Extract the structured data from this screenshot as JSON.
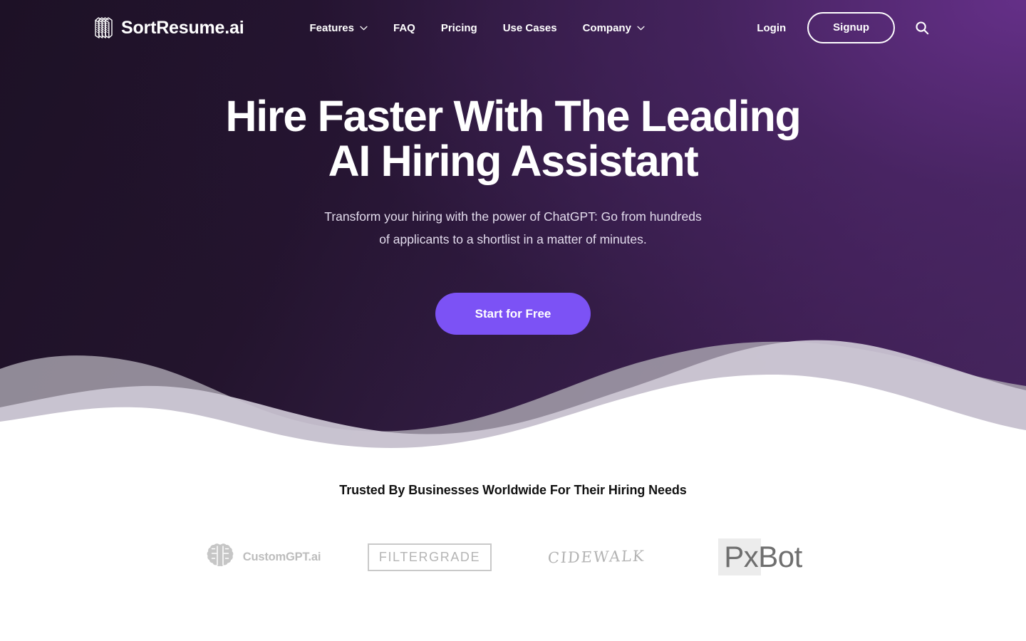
{
  "brand": {
    "name": "SortResume.ai",
    "icon": "stacked-documents-icon"
  },
  "nav": {
    "items": [
      {
        "label": "Features",
        "has_dropdown": true
      },
      {
        "label": "FAQ",
        "has_dropdown": false
      },
      {
        "label": "Pricing",
        "has_dropdown": false
      },
      {
        "label": "Use Cases",
        "has_dropdown": false
      },
      {
        "label": "Company",
        "has_dropdown": true
      }
    ]
  },
  "header_actions": {
    "login_label": "Login",
    "signup_label": "Signup",
    "search_icon": "search-icon"
  },
  "hero": {
    "title_line1": "Hire Faster With The Leading",
    "title_line2": "AI Hiring Assistant",
    "subtitle_line1": "Transform your hiring with the power of ChatGPT: Go from hundreds",
    "subtitle_line2": "of applicants to a shortlist in a matter of minutes.",
    "cta_label": "Start for Free"
  },
  "trusted": {
    "title": "Trusted By Businesses Worldwide For Their Hiring Needs",
    "logos": [
      {
        "name": "CustomGPT.ai",
        "text": "CustomGPT.ai",
        "style": "brain-icon-wordmark"
      },
      {
        "name": "FilterGrade",
        "text": "FILTERGRADE",
        "style": "boxed-wordmark"
      },
      {
        "name": "Cidewalk",
        "text": "CIDEWALK",
        "style": "handwritten-wordmark"
      },
      {
        "name": "PxBot",
        "text": "PxBot",
        "style": "block-wordmark"
      }
    ]
  },
  "colors": {
    "hero_gradient_dark": "#1d1126",
    "hero_gradient_light": "#4c2a66",
    "cta_purple": "#7c52f5",
    "wave_gray": "#aca9b2",
    "wave_lavender": "#cdc8d5",
    "page_background": "#ffffff",
    "logo_gray": "#bdbdbd"
  }
}
